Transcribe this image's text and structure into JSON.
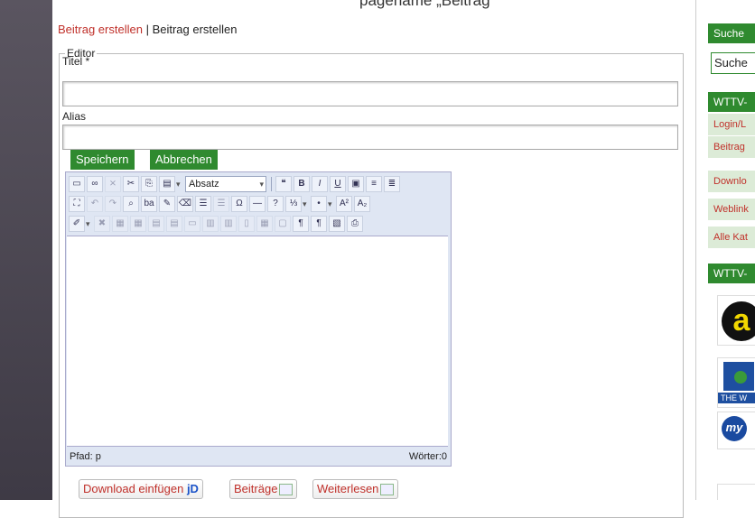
{
  "top_strip_text": "pagename „Beitrag ",
  "breadcrumb": {
    "link": "Beitrag erstellen",
    "separator": " | ",
    "current": "Beitrag erstellen"
  },
  "editor": {
    "legend": "Editor",
    "title_label": "Titel *",
    "title_value": "",
    "alias_label": "Alias",
    "alias_value": "",
    "save_button": "Speichern",
    "cancel_button": "Abbrechen",
    "format_select": "Absatz",
    "status_path": "Pfad: p",
    "status_words": "Wörter:0"
  },
  "insert_buttons": {
    "download": "Download einfügen",
    "download_badge": "jD",
    "articles": "Beiträge",
    "readmore": "Weiterlesen"
  },
  "sidebar": {
    "search_header": "Suche",
    "search_input": "Suche",
    "menu_header": "WTTV-",
    "menu_items": [
      "Login/L",
      "Beitrag",
      "Downlo",
      "Weblink",
      "Alle Kat"
    ],
    "partners_header": "WTTV-",
    "logo_texts": [
      "a",
      "THE W",
      "my"
    ]
  },
  "colors": {
    "accent_green": "#2f8a2f",
    "link_red": "#c0302a"
  }
}
